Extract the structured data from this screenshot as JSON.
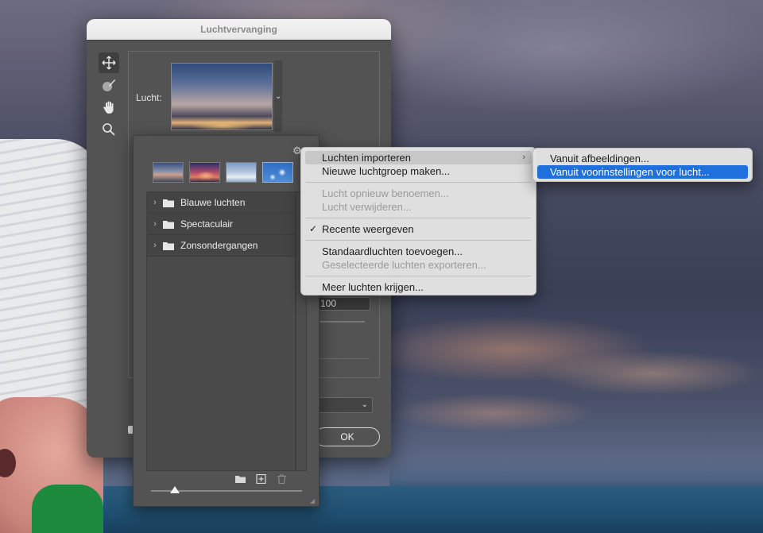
{
  "dialog": {
    "title": "Luchtvervanging",
    "sky_label": "Lucht:",
    "value_field": "100",
    "ok_label": "OK"
  },
  "picker": {
    "groups": [
      {
        "label": "Blauwe luchten"
      },
      {
        "label": "Spectaculair"
      },
      {
        "label": "Zonsondergangen"
      }
    ]
  },
  "menu": {
    "items": [
      {
        "label": "Luchten importeren",
        "has_submenu": true,
        "highlighted": true
      },
      {
        "label": "Nieuwe luchtgroep maken..."
      },
      {
        "label": "Lucht opnieuw benoemen...",
        "disabled": true
      },
      {
        "label": "Lucht verwijderen...",
        "disabled": true
      },
      {
        "label": "Recente weergeven",
        "checked": true
      },
      {
        "label": "Standaardluchten toevoegen..."
      },
      {
        "label": "Geselecteerde luchten exporteren...",
        "disabled": true
      },
      {
        "label": "Meer luchten krijgen..."
      }
    ]
  },
  "submenu": {
    "items": [
      {
        "label": "Vanuit afbeeldingen..."
      },
      {
        "label": "Vanuit voorinstellingen voor lucht...",
        "selected": true
      }
    ]
  },
  "icons": {
    "tools": [
      "move-icon",
      "sky-brush-icon",
      "hand-icon",
      "zoom-icon"
    ],
    "footer": [
      "new-folder-icon",
      "add-sky-icon",
      "trash-icon"
    ],
    "selection_color": "#1f6fdc"
  }
}
